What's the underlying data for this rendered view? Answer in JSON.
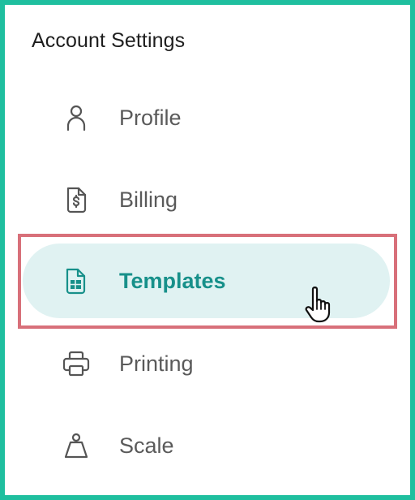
{
  "panel": {
    "title": "Account Settings"
  },
  "nav": {
    "items": [
      {
        "id": "profile",
        "label": "Profile",
        "icon": "user-icon",
        "active": false
      },
      {
        "id": "billing",
        "label": "Billing",
        "icon": "dollar-document-icon",
        "active": false
      },
      {
        "id": "templates",
        "label": "Templates",
        "icon": "spreadsheet-document-icon",
        "active": true
      },
      {
        "id": "printing",
        "label": "Printing",
        "icon": "printer-icon",
        "active": false
      },
      {
        "id": "scale",
        "label": "Scale",
        "icon": "weight-scale-icon",
        "active": false
      }
    ]
  },
  "colors": {
    "frame_border": "#1fbf9f",
    "active_background": "#e0f2f2",
    "active_text": "#17908a",
    "highlight_border": "#d8707a",
    "item_text": "#5a5a5a"
  },
  "cursor": {
    "icon": "hand-pointer-icon"
  }
}
